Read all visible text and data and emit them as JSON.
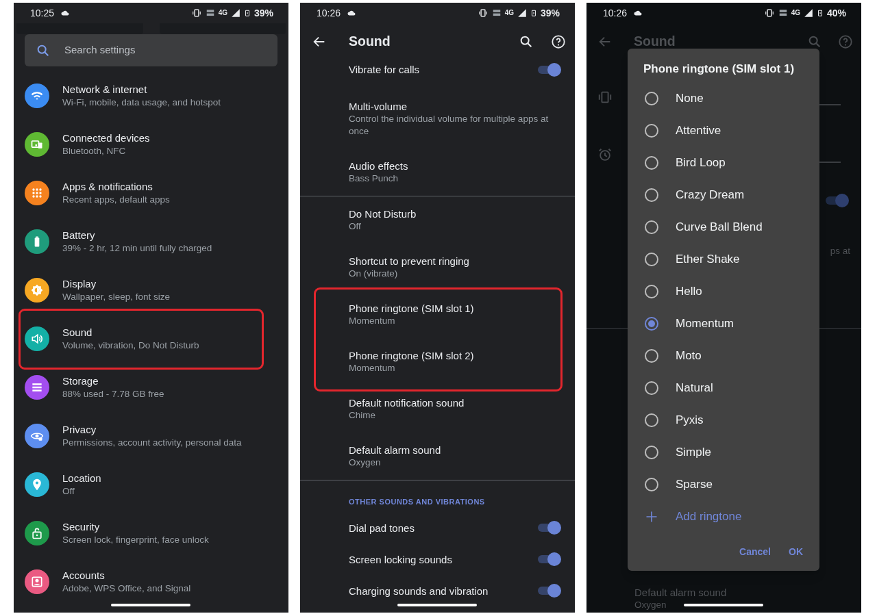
{
  "panels": [
    {
      "kind": "settings",
      "status_bar": {
        "time": "10:25",
        "network": "4G",
        "battery": "39%"
      },
      "search": {
        "placeholder": "Search settings"
      },
      "items": [
        {
          "title": "Network & internet",
          "subtitle": "Wi-Fi, mobile, data usage, and hotspot",
          "color": "#3b8cf2",
          "highlighted": false
        },
        {
          "title": "Connected devices",
          "subtitle": "Bluetooth, NFC",
          "color": "#5fb933",
          "highlighted": false
        },
        {
          "title": "Apps & notifications",
          "subtitle": "Recent apps, default apps",
          "color": "#f5821f",
          "highlighted": false
        },
        {
          "title": "Battery",
          "subtitle": "39% - 2 hr, 12 min until fully charged",
          "color": "#1f9c7c",
          "highlighted": false
        },
        {
          "title": "Display",
          "subtitle": "Wallpaper, sleep, font size",
          "color": "#f7a823",
          "highlighted": false
        },
        {
          "title": "Sound",
          "subtitle": "Volume, vibration, Do Not Disturb",
          "color": "#14b0a6",
          "highlighted": true
        },
        {
          "title": "Storage",
          "subtitle": "88% used - 7.78 GB free",
          "color": "#a34ef0",
          "highlighted": false
        },
        {
          "title": "Privacy",
          "subtitle": "Permissions, account activity, personal data",
          "color": "#5d8ef0",
          "highlighted": false
        },
        {
          "title": "Location",
          "subtitle": "Off",
          "color": "#2ab8d6",
          "highlighted": false
        },
        {
          "title": "Security",
          "subtitle": "Screen lock, fingerprint, face unlock",
          "color": "#1e9a4b",
          "highlighted": false
        },
        {
          "title": "Accounts",
          "subtitle": "Adobe, WPS Office, and Signal",
          "color": "#ea5a82",
          "highlighted": false
        }
      ]
    },
    {
      "kind": "sound",
      "status_bar": {
        "time": "10:26",
        "network": "4G",
        "battery": "39%"
      },
      "toolbar": {
        "title": "Sound"
      },
      "sections": [
        {
          "items": [
            {
              "kind": "toggle",
              "title": "Vibrate for calls",
              "on": true,
              "highlighted": false
            },
            {
              "kind": "entry",
              "title": "Multi-volume",
              "subtitle": "Control the individual volume for multiple apps at once",
              "highlighted": false
            },
            {
              "kind": "entry",
              "title": "Audio effects",
              "subtitle": "Bass Punch",
              "highlighted": false
            }
          ]
        },
        {
          "items": [
            {
              "kind": "entry",
              "title": "Do Not Disturb",
              "subtitle": "Off",
              "highlighted": false
            },
            {
              "kind": "entry",
              "title": "Shortcut to prevent ringing",
              "subtitle": "On (vibrate)",
              "highlighted": false
            },
            {
              "kind": "entry",
              "title": "Phone ringtone (SIM slot 1)",
              "subtitle": "Momentum",
              "highlighted": true
            },
            {
              "kind": "entry",
              "title": "Phone ringtone (SIM slot 2)",
              "subtitle": "Momentum",
              "highlighted": true
            },
            {
              "kind": "entry",
              "title": "Default notification sound",
              "subtitle": "Chime",
              "highlighted": false
            },
            {
              "kind": "entry",
              "title": "Default alarm sound",
              "subtitle": "Oxygen",
              "highlighted": false
            }
          ]
        },
        {
          "header": "OTHER SOUNDS AND VIBRATIONS",
          "items": [
            {
              "kind": "toggle",
              "title": "Dial pad tones",
              "on": true,
              "highlighted": false
            },
            {
              "kind": "toggle",
              "title": "Screen locking sounds",
              "on": true,
              "highlighted": false
            },
            {
              "kind": "toggle",
              "title": "Charging sounds and vibration",
              "on": true,
              "highlighted": false
            }
          ]
        }
      ]
    },
    {
      "kind": "ringtone_dialog",
      "status_bar": {
        "time": "10:26",
        "network": "4G",
        "battery": "40%"
      },
      "background": {
        "toolbar_title": "Sound",
        "toggle_on": true,
        "fragment": "ps at",
        "last_item": {
          "title": "Default alarm sound",
          "subtitle": "Oxygen"
        }
      },
      "dialog": {
        "title": "Phone ringtone (SIM slot 1)",
        "options": [
          {
            "label": "None",
            "selected": false
          },
          {
            "label": "Attentive",
            "selected": false
          },
          {
            "label": "Bird Loop",
            "selected": false
          },
          {
            "label": "Crazy Dream",
            "selected": false
          },
          {
            "label": "Curve Ball Blend",
            "selected": false
          },
          {
            "label": "Ether Shake",
            "selected": false
          },
          {
            "label": "Hello",
            "selected": false
          },
          {
            "label": "Momentum",
            "selected": true
          },
          {
            "label": "Moto",
            "selected": false
          },
          {
            "label": "Natural",
            "selected": false
          },
          {
            "label": "Pyxis",
            "selected": false
          },
          {
            "label": "Simple",
            "selected": false
          },
          {
            "label": "Sparse",
            "selected": false
          }
        ],
        "add_label": "Add ringtone",
        "buttons": [
          "Cancel",
          "OK"
        ]
      }
    }
  ]
}
